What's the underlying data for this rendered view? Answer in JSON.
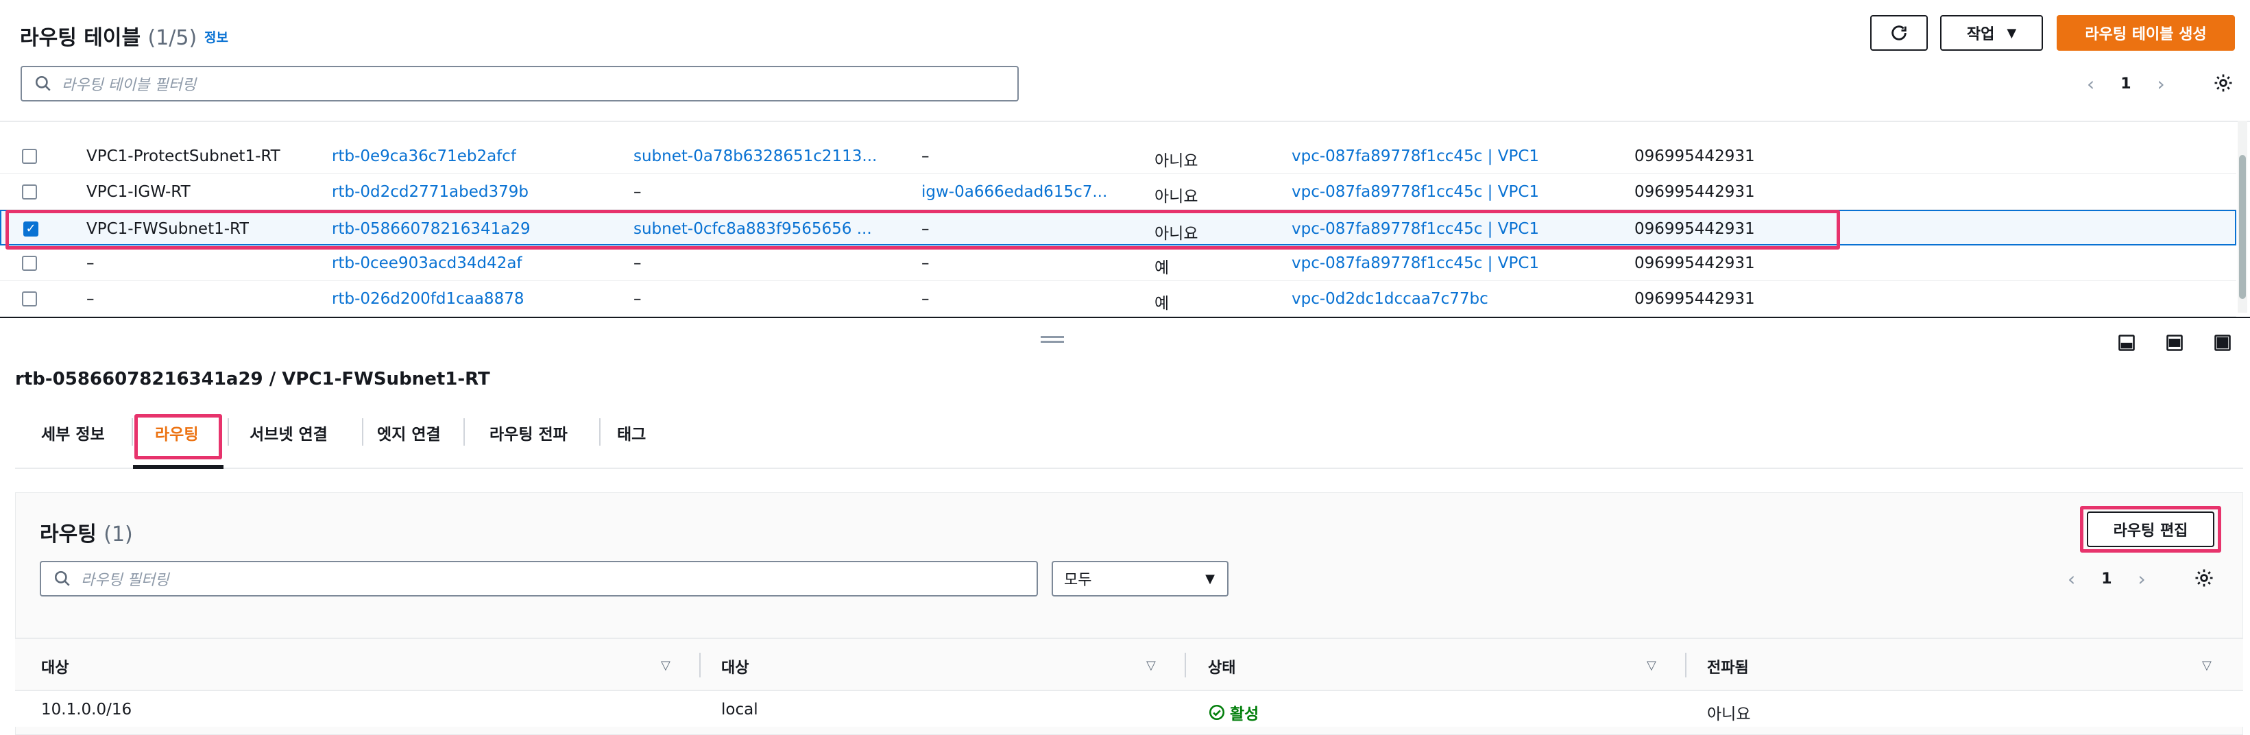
{
  "header": {
    "title": "라우팅 테이블",
    "count": "(1/5)",
    "info": "정보",
    "actions_label": "작업",
    "create_label": "라우팅 테이블 생성",
    "filter_placeholder": "라우팅 테이블 필터링",
    "page": "1"
  },
  "route_tables": [
    {
      "name": "VPC1-ProtectSubnet1-RT",
      "id": "rtb-0e9ca36c71eb2afcf",
      "subnet": "subnet-0a78b6328651c2113...",
      "edge": "–",
      "main": "아니요",
      "vpc": "vpc-087fa89778f1cc45c | VPC1",
      "owner": "096995442931",
      "checked": false
    },
    {
      "name": "VPC1-IGW-RT",
      "id": "rtb-0d2cd2771abed379b",
      "subnet": "–",
      "edge": "igw-0a666edad615c7...",
      "main": "아니요",
      "vpc": "vpc-087fa89778f1cc45c | VPC1",
      "owner": "096995442931",
      "checked": false
    },
    {
      "name": "VPC1-FWSubnet1-RT",
      "id": "rtb-05866078216341a29",
      "subnet": "subnet-0cfc8a883f9565656 ...",
      "edge": "–",
      "main": "아니요",
      "vpc": "vpc-087fa89778f1cc45c | VPC1",
      "owner": "096995442931",
      "checked": true
    },
    {
      "name": "–",
      "id": "rtb-0cee903acd34d42af",
      "subnet": "–",
      "edge": "–",
      "main": "예",
      "vpc": "vpc-087fa89778f1cc45c | VPC1",
      "owner": "096995442931",
      "checked": false
    },
    {
      "name": "–",
      "id": "rtb-026d200fd1caa8878",
      "subnet": "–",
      "edge": "–",
      "main": "예",
      "vpc": "vpc-0d2dc1dccaa7c77bc",
      "owner": "096995442931",
      "checked": false
    }
  ],
  "detail": {
    "title": "rtb-05866078216341a29 / VPC1-FWSubnet1-RT",
    "tabs": [
      "세부 정보",
      "라우팅",
      "서브넷 연결",
      "엣지 연결",
      "라우팅 전파",
      "태그"
    ],
    "active_tab": "라우팅"
  },
  "routes": {
    "title": "라우팅",
    "count": "(1)",
    "edit_label": "라우팅 편집",
    "filter_placeholder": "라우팅 필터링",
    "filter_select": "모두",
    "page": "1",
    "columns": [
      "대상",
      "대상",
      "상태",
      "전파됨"
    ],
    "rows": [
      {
        "destination": "10.1.0.0/16",
        "target": "local",
        "status": "활성",
        "propagated": "아니요"
      }
    ]
  },
  "colors": {
    "accent": "#ec7211",
    "link": "#0972d3",
    "highlight": "#e7336c",
    "success": "#037f0c"
  }
}
